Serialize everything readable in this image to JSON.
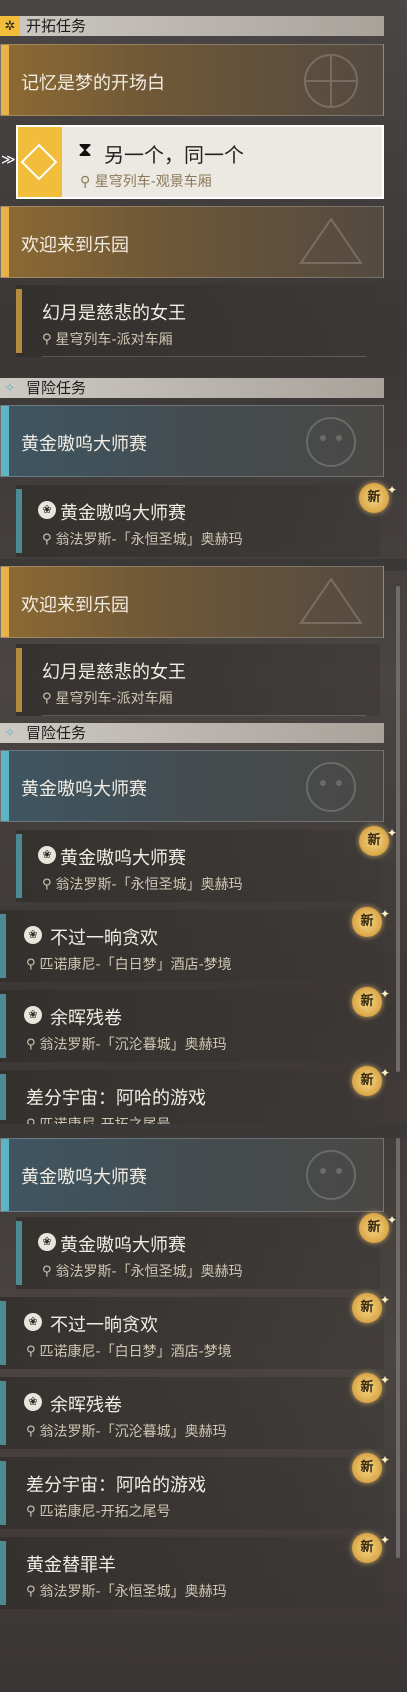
{
  "sections": {
    "trailblaze": "开拓任务",
    "adventure": "冒险任务"
  },
  "quests": {
    "memory": "记忆是梦的开场白",
    "another_same": "另一个，同一个",
    "another_loc": "星穹列车-观景车厢",
    "welcome": "欢迎来到乐园",
    "dreamwalker": "幻月是慈悲的女王",
    "dreamwalker_loc": "星穹列车-派对车厢",
    "golden": "黄金嗷呜大师赛",
    "golden_loc": "翁法罗斯-「永恒圣城」奥赫玛",
    "not_greedy": "不过一晌贪欢",
    "not_greedy_loc": "匹诺康尼-「白日梦」酒店-梦境",
    "afterglow": "余晖残卷",
    "afterglow_loc": "翁法罗斯-「沉沦暮城」奥赫玛",
    "diff_universe": "差分宇宙：阿哈的游戏",
    "diff_universe_loc": "匹诺康尼-开拓之尾号",
    "scapegoat": "黄金替罪羊",
    "scapegoat_loc": "翁法罗斯-「永恒圣城」奥赫玛"
  },
  "badge_new": "新",
  "icons": {
    "trailblaze": "compass-icon",
    "adventure": "diamond-icon",
    "location": "pin-icon",
    "new": "new-badge-icon",
    "quest": "quest-type-icon",
    "hourglass": "hourglass-icon"
  }
}
